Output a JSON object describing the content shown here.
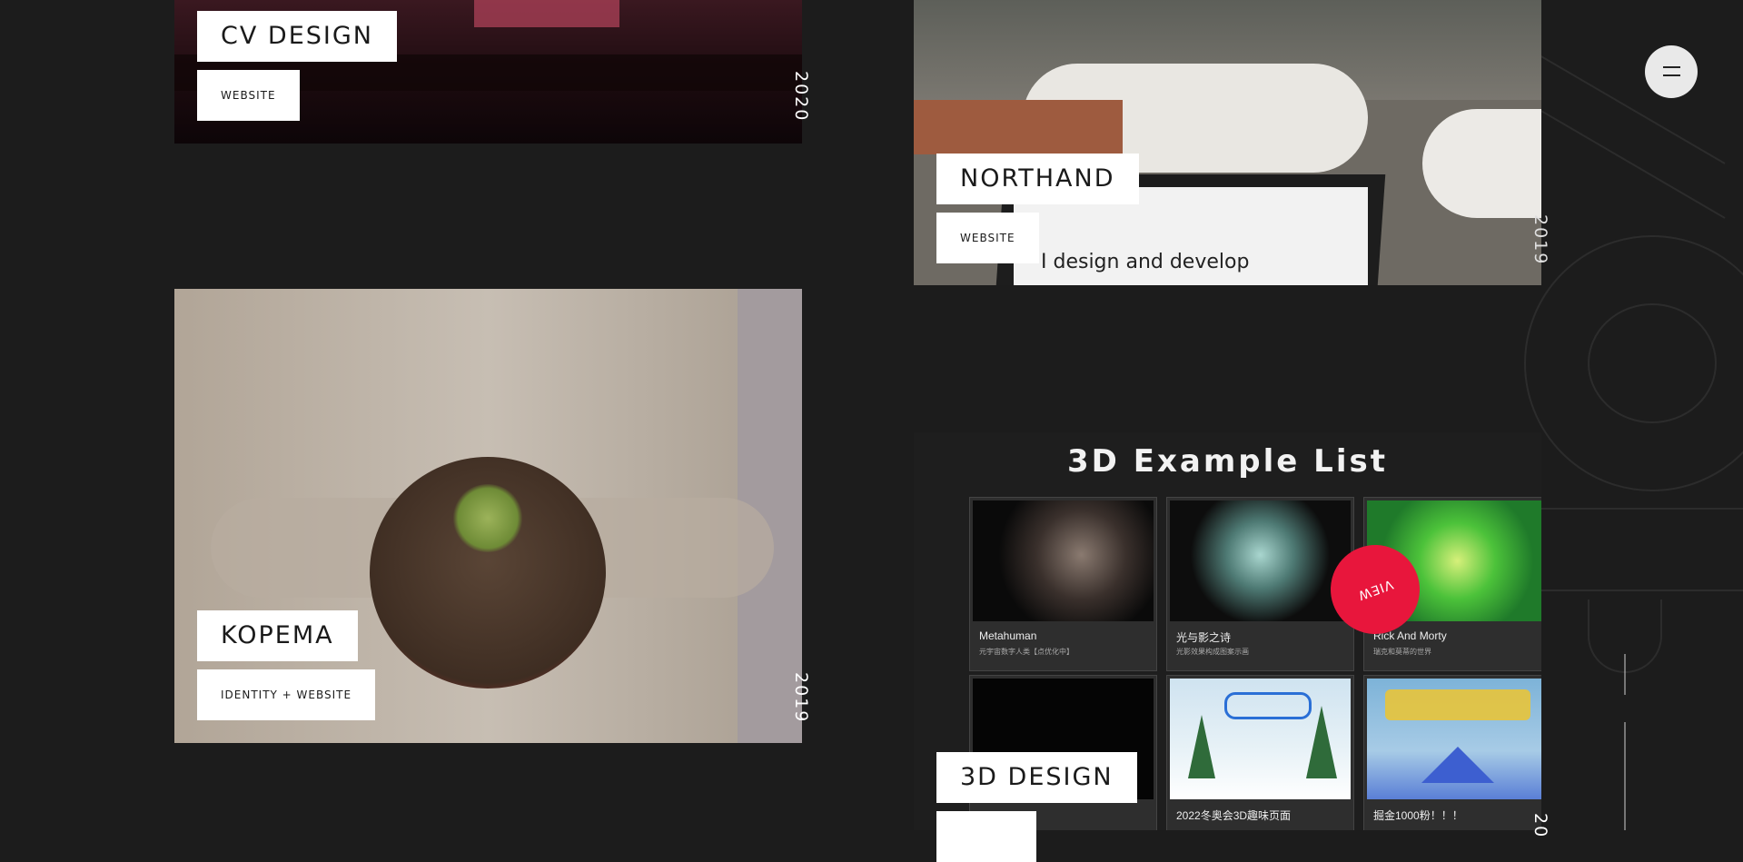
{
  "menu": {
    "icon": "hamburger-icon"
  },
  "projects": [
    {
      "title": "CV DESIGN",
      "category": "WEBSITE",
      "year": "2020"
    },
    {
      "title": "NORTHAND",
      "category": "WEBSITE",
      "year": "2019",
      "screen_text": "I design and develop"
    },
    {
      "title": "KOPEMA",
      "category": "IDENTITY + WEBSITE",
      "year": "2019"
    },
    {
      "title": "3D DESIGN",
      "category": "",
      "year": "20"
    }
  ],
  "view_button": {
    "label": "VIEW"
  },
  "example_list": {
    "heading": "3D Example List",
    "tiles": [
      {
        "name": "Metahuman",
        "desc": "元宇宙数字人类【点优化中】"
      },
      {
        "name": "光与影之诗",
        "desc": "光影效果构成图案示画"
      },
      {
        "name": "Rick And Morty",
        "desc": "瑞克和莫蒂的世界"
      },
      {
        "name": "",
        "desc": ""
      },
      {
        "name": "2022冬奥会3D趣味页面",
        "desc": ""
      },
      {
        "name": "掘金1000粉！！！",
        "desc": ""
      }
    ]
  },
  "colors": {
    "background": "#1c1c1c",
    "accent": "#e8163c"
  }
}
